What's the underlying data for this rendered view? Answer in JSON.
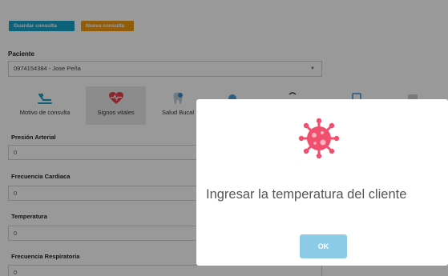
{
  "toolbar": {
    "save_label": "Guardar consulta",
    "new_label": "Nueva consulta",
    "save_color": "#17a2c8",
    "new_color": "#f39c12"
  },
  "patient": {
    "label": "Paciente",
    "selected": "0974154384 - Jose Peña"
  },
  "tabs": [
    {
      "label": "Motivo de consulta",
      "icon": "patient-bed-icon"
    },
    {
      "label": "Signos vitales",
      "icon": "heart-pulse-icon",
      "active": true
    },
    {
      "label": "Salud Bucal",
      "icon": "tooth-icon"
    },
    {
      "label": "",
      "icon": "tab-icon-4"
    },
    {
      "label": "",
      "icon": "tab-icon-5"
    },
    {
      "label": "",
      "icon": "tab-icon-6"
    },
    {
      "label": "",
      "icon": "tab-icon-7"
    }
  ],
  "fields": [
    {
      "label": "Presión Arterial",
      "value": "0"
    },
    {
      "label": "Frecuencia Cardiaca",
      "value": "0"
    },
    {
      "label": "Temperatura",
      "value": "0"
    },
    {
      "label": "Frecuencia Respiratoria",
      "value": "0"
    }
  ],
  "modal": {
    "icon": "virus-icon",
    "icon_color": "#f0506e",
    "message": "Ingresar la temperatura del cliente",
    "ok_label": "OK"
  }
}
